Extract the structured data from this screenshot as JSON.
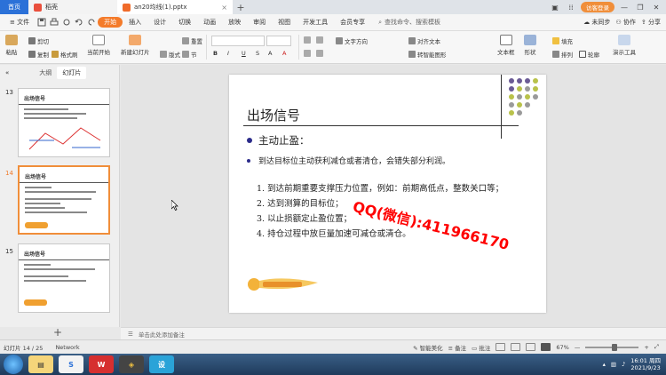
{
  "tabs": {
    "home": "首页",
    "tab1": "稻壳",
    "tab2": "an20均线(1).pptx",
    "user_badge": "访客登录"
  },
  "menu": {
    "file": "文件",
    "start": "开始",
    "insert": "插入",
    "design": "设计",
    "transition": "切换",
    "animation": "动画",
    "slideshow": "放映",
    "review": "审阅",
    "view": "视图",
    "developer": "开发工具",
    "vip": "会员专享",
    "search_placeholder": "查找命令、搜索模板",
    "unsynced": "未同步",
    "collab": "协作",
    "share": "分享"
  },
  "ribbon": {
    "paste": "粘贴",
    "cut": "剪切",
    "copy": "复制",
    "format_painter": "格式刷",
    "from_current": "当前开始",
    "new_slide": "新建幻灯片",
    "layout": "版式",
    "section": "节",
    "reset": "重置",
    "text_direction": "文字方向",
    "align_text": "对齐文本",
    "smartart": "转智能图形",
    "textbox": "文本框",
    "shape": "形状",
    "arrange": "排列",
    "outline": "轮廓",
    "fill": "填充",
    "presentation_tools": "演示工具"
  },
  "leftpanel": {
    "tab_outline": "大纲",
    "tab_slides": "幻灯片",
    "slides": [
      {
        "num": "13",
        "title": "出场信号"
      },
      {
        "num": "14",
        "title": "出场信号"
      },
      {
        "num": "15",
        "title": "出场信号"
      }
    ]
  },
  "slide": {
    "title": "出场信号",
    "bullet1": "主动止盈：",
    "bullet2": "到达目标位主动获利减仓或者清仓，会错失部分利润。",
    "items": [
      "1. 到达前期重要支撑压力位置，例如：前期高低点，整数关口等；",
      "2. 达到测算的目标位；",
      "3. 以止损额定止盈位置；",
      "4. 持仓过程中放巨量加速可减仓或清仓。"
    ],
    "watermark": "QQ(微信):411966170"
  },
  "notes": {
    "placeholder": "单击此处添加备注"
  },
  "status": {
    "slide_counter": "幻灯片 14 / 25",
    "network": "Network",
    "beautify": "智能美化",
    "notes": "备注",
    "comments": "批注",
    "zoom": "67%"
  },
  "taskbar": {
    "time": "16:01 周四",
    "date": "2021/9/23"
  },
  "colors": {
    "accent": "#f47b2a",
    "blue": "#2b71d8",
    "watermark": "#ff0000"
  }
}
